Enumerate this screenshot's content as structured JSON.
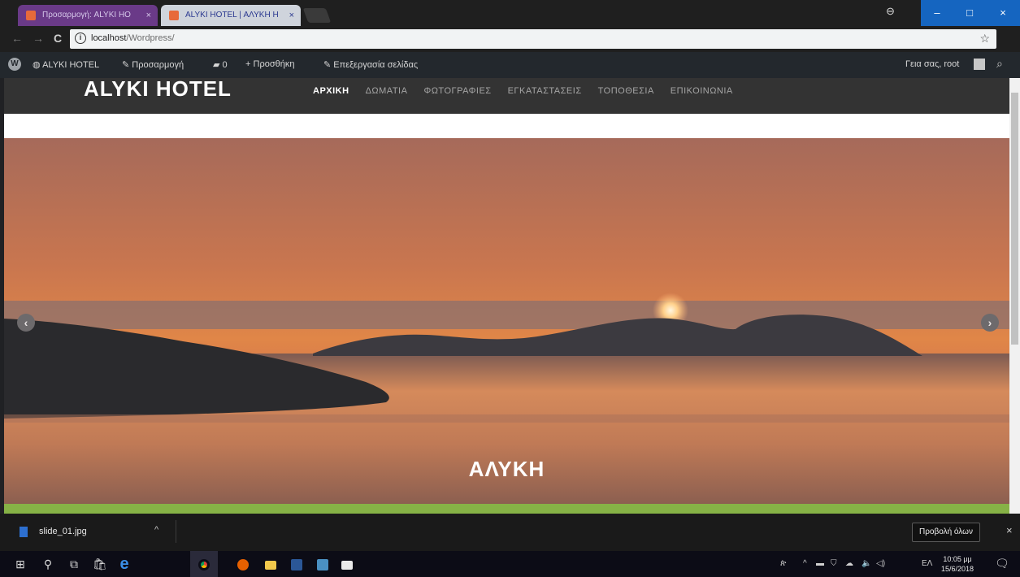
{
  "browser": {
    "tabs": [
      {
        "label": "Προσαρμογή: ALYKI HO"
      },
      {
        "label": "ALYKI HOTEL | ΑΛΥΚΗ Η"
      }
    ],
    "tab_close": "×",
    "url_host": "localhost",
    "url_path": "/Wordpress/",
    "info_glyph": "i",
    "star": "☆",
    "window_buttons": {
      "minimize": "–",
      "maximize": "□",
      "close": "×"
    },
    "account_icon": "⊖",
    "nav_icons": {
      "back": "←",
      "forward": "→",
      "reload": "C"
    }
  },
  "admin_bar": {
    "wp_logo": "W",
    "site_name": "ALYKI HOTEL",
    "customize": "Προσαρμογή",
    "comments_count": "0",
    "add_new": "Προσθήκη",
    "edit_page": "Επεξεργασία σελίδας",
    "greeting": "Γεια σας, root",
    "search_icon": "⌕",
    "glyphs": {
      "home": "◍",
      "customize": "✎",
      "comments": "▰",
      "add": "+",
      "edit": "✎"
    }
  },
  "site": {
    "logo": "ALYKI HOTEL",
    "menu": [
      {
        "label": "ΑΡΧΙΚΗ",
        "active": true
      },
      {
        "label": "ΔΩΜΑΤΙΑ",
        "active": false
      },
      {
        "label": "ΦΩΤΟΓΡΑΦΙΕΣ",
        "active": false
      },
      {
        "label": "ΕΓΚΑΤΑΣΤΑΣΕΙΣ",
        "active": false
      },
      {
        "label": "ΤΟΠΟΘΕΣΙΑ",
        "active": false
      },
      {
        "label": "ΕΠΙΚΟΙΝΩΝΙΑ",
        "active": false
      }
    ]
  },
  "slider": {
    "caption": "ΑΛΥΚΗ",
    "prev": "‹",
    "next": "›"
  },
  "download_bar": {
    "file_name": "slide_01.jpg",
    "chevron": "^",
    "show_all": "Προβολή όλων",
    "close": "×"
  },
  "taskbar": {
    "start": "⊞",
    "search": "⚲",
    "task_view": "⧉",
    "store": "🛍",
    "edge": "e",
    "tray": {
      "people": "ጵ",
      "chevron": "^",
      "network": "▬",
      "shield": "⛉",
      "cloud": "☁",
      "volume": "🔈",
      "speaker": "◁)",
      "lang": "ΕΛ"
    },
    "clock_time": "10:05 μμ",
    "clock_date": "15/6/2018",
    "notification": "🗨"
  },
  "colors": {
    "admin_bar": "#23282d",
    "header": "#333333",
    "accent_green": "#86b246",
    "sunset_top": "#b46a55",
    "sunset_mid": "#e18a4f"
  }
}
